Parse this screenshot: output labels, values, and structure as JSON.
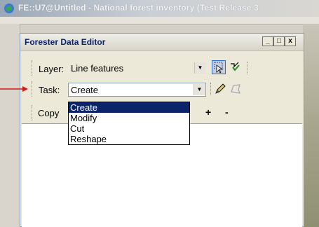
{
  "app": {
    "title": "FE::U7@Untitled - National forest inventory (Test Release 3"
  },
  "editor": {
    "title": "Forester Data Editor",
    "buttons": {
      "minimize": "_",
      "maximize": "□",
      "close": "x"
    },
    "layer": {
      "label": "Layer:",
      "value": "Line features"
    },
    "task": {
      "label": "Task:",
      "value": "Create"
    },
    "copy": {
      "label": "Copy"
    },
    "toolbar_plus": "+",
    "toolbar_minus": "-",
    "task_options": [
      "Create",
      "Modify",
      "Cut",
      "Reshape"
    ],
    "selected_option": "Create"
  },
  "icons": [
    "app-logo-icon",
    "select-features-icon",
    "edit-vertices-icon",
    "pencil-icon",
    "polygon-icon",
    "arrow-icon"
  ],
  "colors": {
    "selection": "#0a246a",
    "annotation_arrow": "#d21a1a",
    "title_text": "#0a246a"
  }
}
